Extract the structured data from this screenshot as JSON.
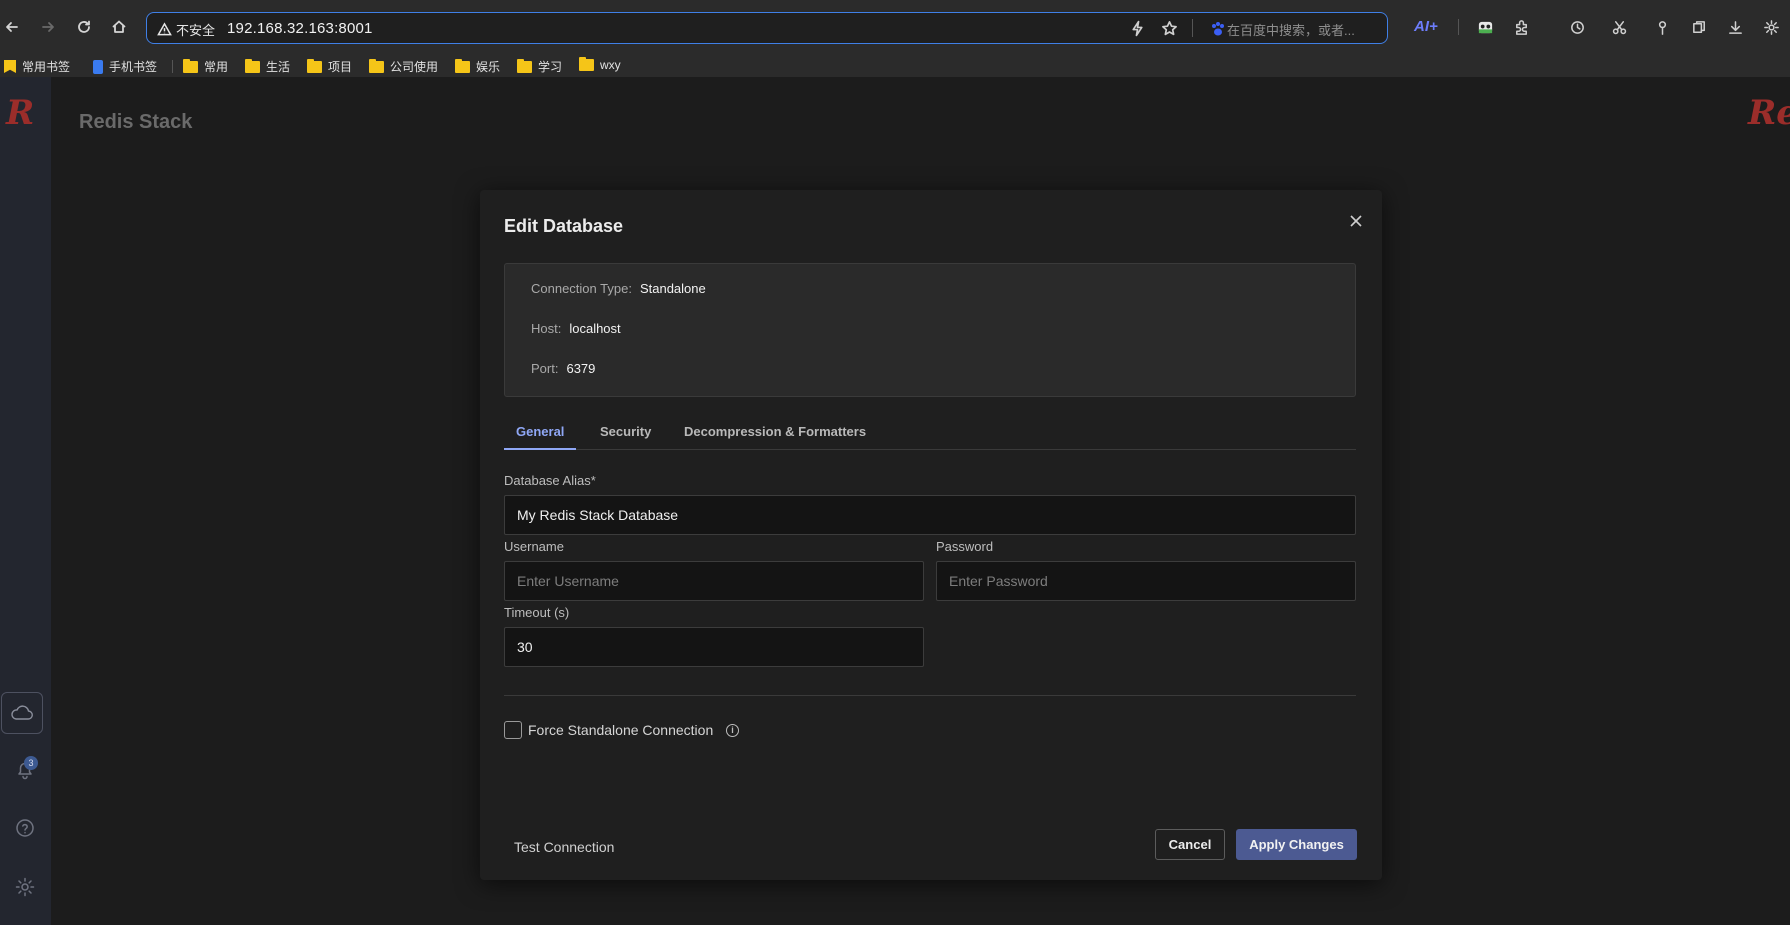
{
  "browser": {
    "security_warning": "不安全",
    "url": "192.168.32.163:8001",
    "search_placeholder": "在百度中搜索，或者...",
    "ai_label": "AI+"
  },
  "bookmarks": [
    {
      "label": "常用书签",
      "icon": "star-bookmark-icon"
    },
    {
      "label": "手机书签",
      "icon": "phone-icon"
    },
    {
      "label": "常用",
      "icon": "folder-icon"
    },
    {
      "label": "生活",
      "icon": "folder-icon"
    },
    {
      "label": "项目",
      "icon": "folder-icon"
    },
    {
      "label": "公司使用",
      "icon": "folder-icon"
    },
    {
      "label": "娱乐",
      "icon": "folder-icon"
    },
    {
      "label": "学习",
      "icon": "folder-icon"
    },
    {
      "label": "wxy",
      "icon": "folder-icon"
    }
  ],
  "app": {
    "title": "Redis Stack",
    "logo_text": "R",
    "logo_text_right": "Re",
    "notification_count": "3"
  },
  "modal": {
    "title": "Edit Database",
    "connection_info": {
      "connection_type_label": "Connection Type:",
      "connection_type_value": "Standalone",
      "host_label": "Host:",
      "host_value": "localhost",
      "port_label": "Port:",
      "port_value": "6379"
    },
    "tabs": [
      "General",
      "Security",
      "Decompression & Formatters"
    ],
    "active_tab": "General",
    "fields": {
      "alias_label": "Database Alias*",
      "alias_value": "My Redis Stack Database",
      "username_label": "Username",
      "username_placeholder": "Enter Username",
      "password_label": "Password",
      "password_placeholder": "Enter Password",
      "timeout_label": "Timeout (s)",
      "timeout_value": "30"
    },
    "force_standalone_label": "Force Standalone Connection",
    "force_standalone_checked": false,
    "info_glyph": "i",
    "test_connection_label": "Test Connection",
    "cancel_label": "Cancel",
    "apply_label": "Apply Changes"
  },
  "colors": {
    "accent": "#8fa7f5",
    "primary_button": "#4c5a92",
    "brand_red": "#9b2d2a",
    "address_focus": "#3f7fe6"
  }
}
